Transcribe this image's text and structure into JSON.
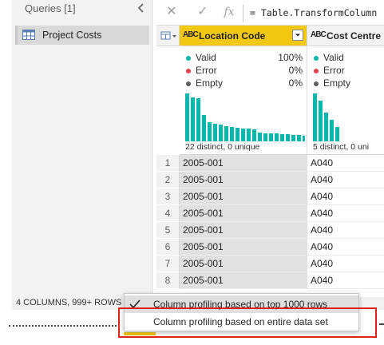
{
  "queries": {
    "header": "Queries [1]",
    "items": [
      {
        "label": "Project Costs",
        "icon": "table-icon"
      }
    ]
  },
  "formula_bar": {
    "cancel": "✕",
    "confirm": "✓",
    "fx": "fx",
    "formula": "= Table.TransformColumn"
  },
  "columns": [
    {
      "type_icon": "ABC",
      "title": "Location Code",
      "selected": true,
      "profile": {
        "valid_label": "Valid",
        "valid_pct": "100%",
        "error_label": "Error",
        "error_pct": "0%",
        "empty_label": "Empty",
        "empty_pct": "0%"
      },
      "distribution": [
        1.0,
        0.92,
        0.9,
        0.55,
        0.4,
        0.37,
        0.35,
        0.32,
        0.3,
        0.28,
        0.27,
        0.26,
        0.25,
        0.18,
        0.17,
        0.16,
        0.16,
        0.15,
        0.15,
        0.14,
        0.13,
        0.12
      ],
      "distinct": "22 distinct, 0 unique"
    },
    {
      "type_icon": "ABC",
      "title": "Cost Centre",
      "selected": false,
      "profile": {
        "valid_label": "Valid",
        "error_label": "Error",
        "empty_label": "Empty"
      },
      "distribution": [
        1.0,
        0.85,
        0.6,
        0.45,
        0.3
      ],
      "distinct": "5 distinct, 0 uni"
    }
  ],
  "rows": [
    {
      "n": "1",
      "location": "2005-001",
      "cost": "A040"
    },
    {
      "n": "2",
      "location": "2005-001",
      "cost": "A040"
    },
    {
      "n": "3",
      "location": "2005-001",
      "cost": "A040"
    },
    {
      "n": "4",
      "location": "2005-001",
      "cost": "A040"
    },
    {
      "n": "5",
      "location": "2005-001",
      "cost": "A040"
    },
    {
      "n": "6",
      "location": "2005-001",
      "cost": "A040"
    },
    {
      "n": "7",
      "location": "2005-001",
      "cost": "A040"
    },
    {
      "n": "8",
      "location": "2005-001",
      "cost": "A040"
    }
  ],
  "status": {
    "summary": "4 COLUMNS, 999+ ROWS"
  },
  "context_menu": {
    "items": [
      {
        "label": "Column profiling based on top 1000 rows",
        "checked": true
      },
      {
        "label": "Column profiling based on entire data set",
        "checked": false
      }
    ]
  },
  "colors": {
    "accent": "#f2c811",
    "bar": "#01b8aa",
    "valid": "#01b8aa",
    "error": "#e8464a",
    "empty": "#605e5c",
    "highlight": "#e0201b"
  }
}
